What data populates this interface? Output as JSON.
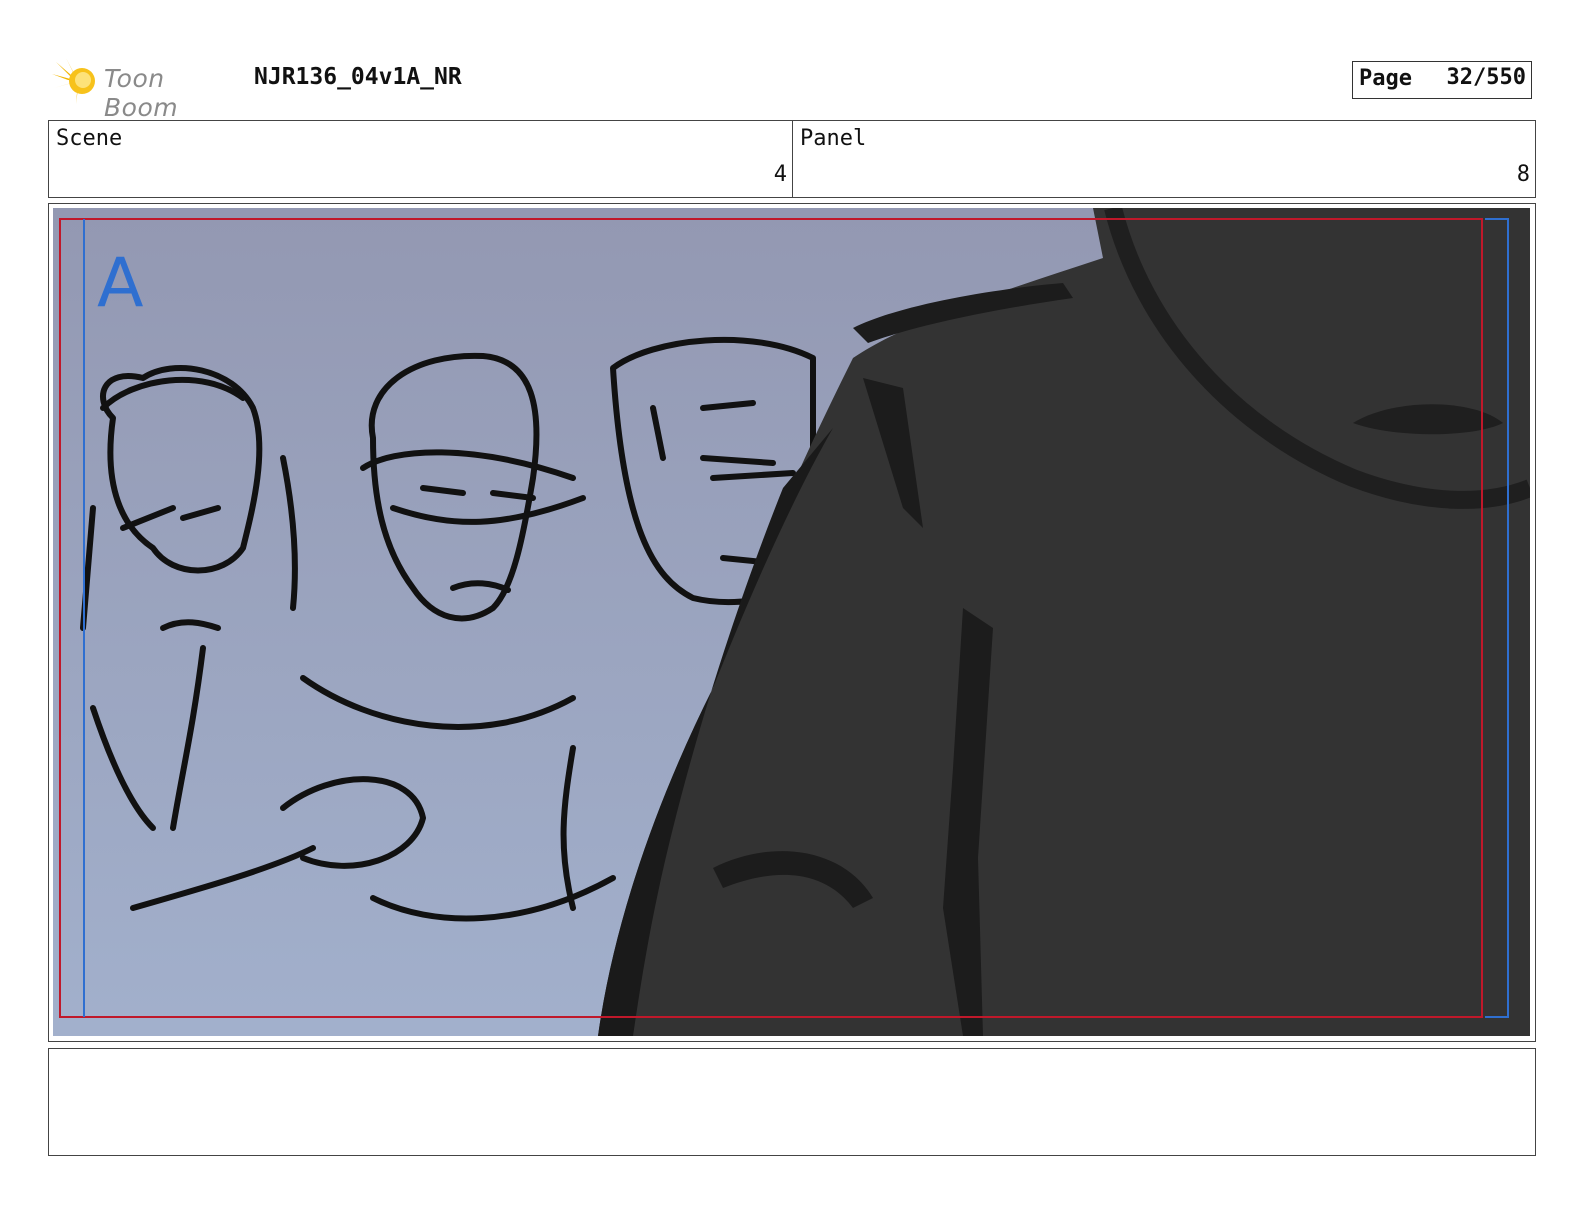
{
  "header": {
    "brand": "Toon Boom",
    "project": "NJR136_04v1A_NR",
    "page_label": "Page",
    "page_value": "32/550"
  },
  "info": {
    "scene_label": "Scene",
    "scene_value": "4",
    "panel_label": "Panel",
    "panel_value": "8"
  },
  "panel": {
    "layer_marker": "A"
  },
  "caption": {
    "text": ""
  },
  "colors": {
    "sky_top": "#9398b2",
    "sky_bottom": "#a2b0cc",
    "silhouette": "#333333",
    "safe_frame": "#c0182a",
    "guide_blue": "#2f6fd0"
  }
}
